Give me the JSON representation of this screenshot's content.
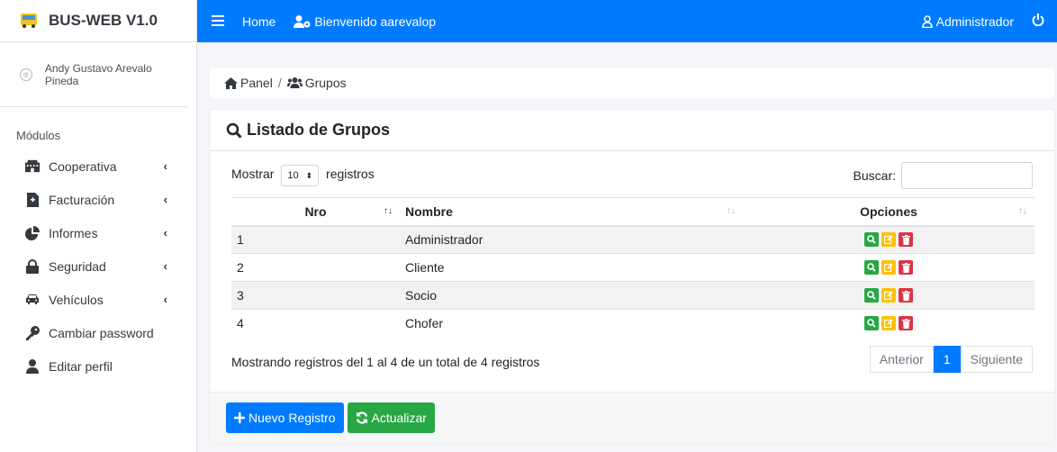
{
  "brand": {
    "title": "BUS-WEB V1.0",
    "icon": "bus-icon"
  },
  "user": {
    "name": "Andy Gustavo Arevalo Pineda"
  },
  "sidebar": {
    "header": "Módulos",
    "items": [
      {
        "label": "Cooperativa",
        "icon": "building-icon",
        "chevron": "‹"
      },
      {
        "label": "Facturación",
        "icon": "file-invoice-icon",
        "chevron": "‹"
      },
      {
        "label": "Informes",
        "icon": "pie-chart-icon",
        "chevron": "‹"
      },
      {
        "label": "Seguridad",
        "icon": "lock-icon",
        "chevron": "‹"
      },
      {
        "label": "Vehículos",
        "icon": "car-icon",
        "chevron": "‹"
      },
      {
        "label": "Cambiar password",
        "icon": "key-icon"
      },
      {
        "label": "Editar perfil",
        "icon": "user-icon"
      }
    ]
  },
  "topbar": {
    "home": "Home",
    "welcome": "Bienvenido aarevalop",
    "admin": "Administrador",
    "color": "#007bff"
  },
  "breadcrumb": {
    "panel": "Panel",
    "sep": "/",
    "current": "Grupos"
  },
  "card": {
    "title": "Listado de Grupos",
    "show_label": "Mostrar",
    "show_value": "10",
    "show_suffix": "registros",
    "search_label": "Buscar:",
    "search_value": "",
    "columns": [
      "Nro",
      "Nombre",
      "Opciones"
    ],
    "rows": [
      {
        "nro": "1",
        "nombre": "Administrador"
      },
      {
        "nro": "2",
        "nombre": "Cliente"
      },
      {
        "nro": "3",
        "nombre": "Socio"
      },
      {
        "nro": "4",
        "nombre": "Chofer"
      }
    ],
    "info": "Mostrando registros del 1 al 4 de un total de 4 registros",
    "pager": {
      "prev": "Anterior",
      "page": "1",
      "next": "Siguiente"
    },
    "buttons": {
      "new": "Nuevo Registro",
      "refresh": "Actualizar"
    }
  }
}
